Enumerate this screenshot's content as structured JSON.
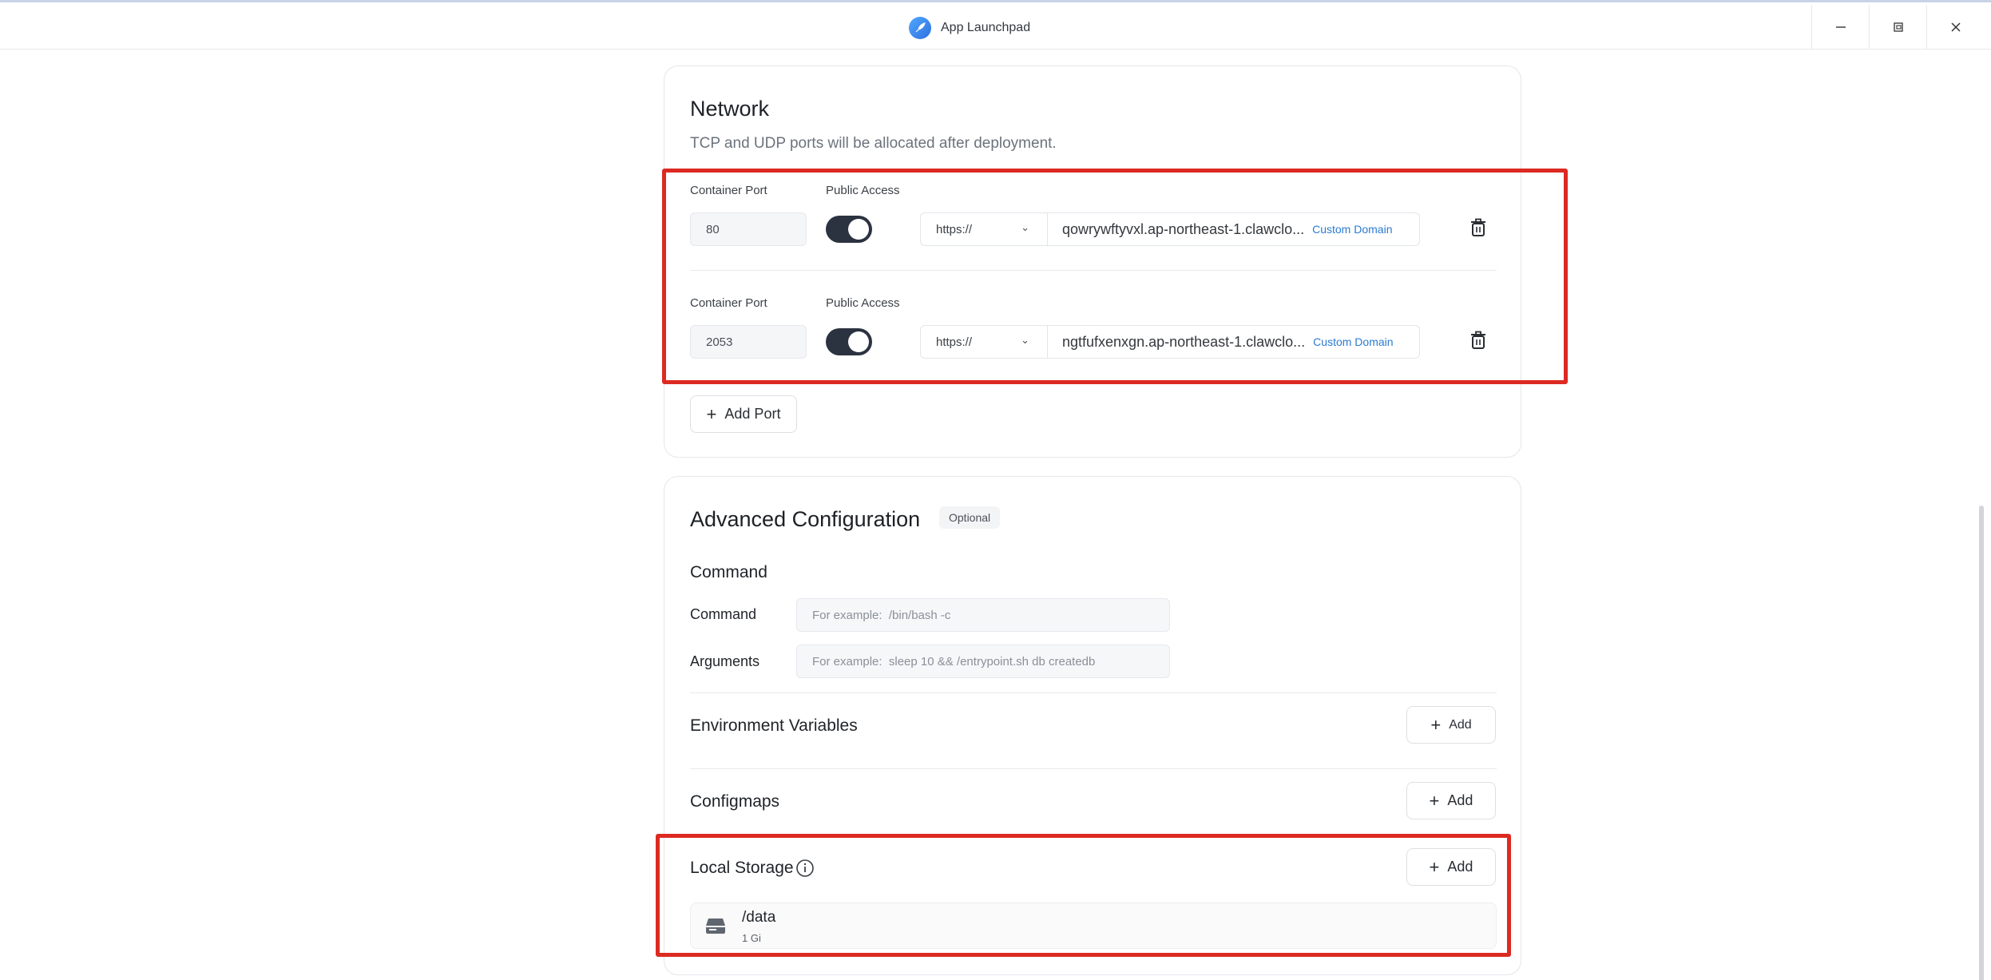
{
  "window": {
    "title": "App Launchpad",
    "controls": {
      "minimize": "—",
      "restore": "⧉",
      "close": "✕"
    }
  },
  "network": {
    "title": "Network",
    "description": "TCP and UDP ports will be allocated after deployment.",
    "ports": [
      {
        "container_port_label": "Container Port",
        "public_access_label": "Public Access",
        "port": "80",
        "public_access": true,
        "protocol": "https://",
        "host": "qowrywftyvxl.ap-northeast-1.clawclo...",
        "custom_domain": "Custom Domain"
      },
      {
        "container_port_label": "Container Port",
        "public_access_label": "Public Access",
        "port": "2053",
        "public_access": true,
        "protocol": "https://",
        "host": "ngtfufxenxgn.ap-northeast-1.clawclo...",
        "custom_domain": "Custom Domain"
      }
    ],
    "add_port_label": "Add Port"
  },
  "advanced": {
    "title": "Advanced Configuration",
    "badge": "Optional",
    "command_section": "Command",
    "command_label": "Command",
    "command_placeholder": "For example:  /bin/bash -c",
    "arguments_label": "Arguments",
    "arguments_placeholder": "For example:  sleep 10 && /entrypoint.sh db createdb",
    "env_title": "Environment Variables",
    "configmaps_title": "Configmaps",
    "local_storage_title": "Local Storage",
    "add_label": "Add",
    "storage": [
      {
        "path": "/data",
        "size": "1 Gi"
      }
    ]
  },
  "colors": {
    "highlight": "#dc2a22",
    "toggle_on": "#2b3240",
    "link": "#2b7bd0"
  }
}
